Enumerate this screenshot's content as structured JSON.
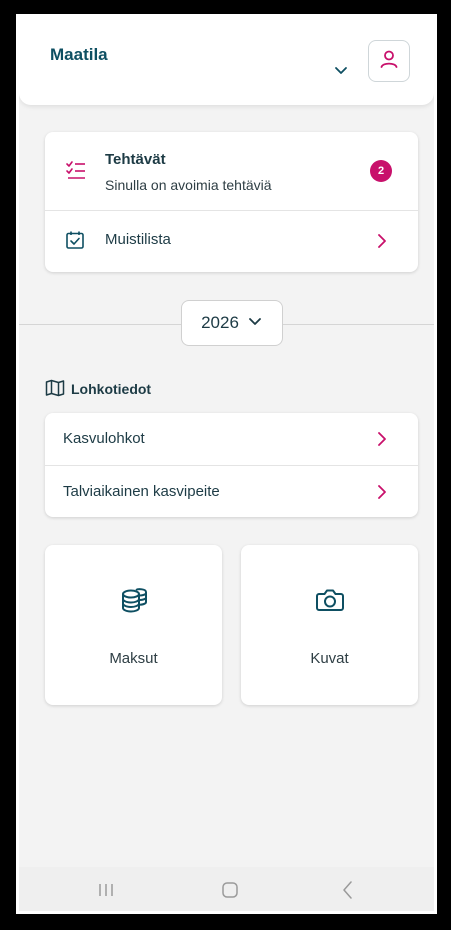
{
  "header": {
    "farm_title": "Maatila"
  },
  "tasks_card": {
    "tasks_title": "Tehtävät",
    "tasks_subtitle": "Sinulla on avoimia tehtäviä",
    "tasks_badge": "2",
    "notes_label": "Muistilista"
  },
  "year_selector": {
    "year": "2026"
  },
  "parcels": {
    "section_title": "Lohkotiedot",
    "items": [
      {
        "label": "Kasvulohkot"
      },
      {
        "label": "Talviaikainen kasvipeite"
      }
    ]
  },
  "tiles": [
    {
      "label": "Maksut",
      "icon": "coins-icon"
    },
    {
      "label": "Kuvat",
      "icon": "camera-icon"
    }
  ],
  "colors": {
    "accent": "#c8106b",
    "primary_text": "#0e4f62",
    "background": "#f3f3f3"
  },
  "nav": {
    "items": [
      "recent-apps-icon",
      "home-icon",
      "back-icon"
    ]
  }
}
